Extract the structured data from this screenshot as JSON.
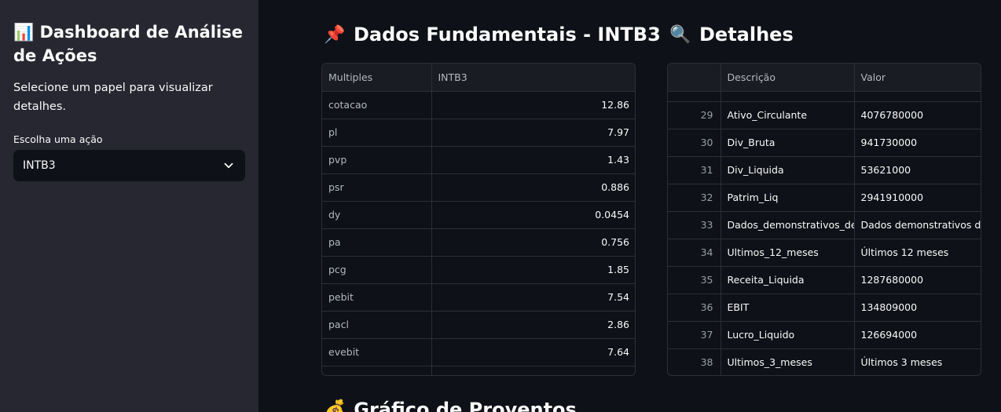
{
  "sidebar": {
    "title_icon": "📊",
    "title": "Dashboard de Análise de Ações",
    "description": "Selecione um papel para visualizar detalhes.",
    "select_label": "Escolha uma ação",
    "selected_value": "INTB3"
  },
  "fundamentals": {
    "icon": "📌",
    "title": "Dados Fundamentais - INTB3",
    "columns": [
      "Multiples",
      "INTB3"
    ],
    "rows": [
      [
        "cotacao",
        "12.86"
      ],
      [
        "pl",
        "7.97"
      ],
      [
        "pvp",
        "1.43"
      ],
      [
        "psr",
        "0.886"
      ],
      [
        "dy",
        "0.0454"
      ],
      [
        "pa",
        "0.756"
      ],
      [
        "pcg",
        "1.85"
      ],
      [
        "pebit",
        "7.54"
      ],
      [
        "pacl",
        "2.86"
      ],
      [
        "evebit",
        "7.64"
      ]
    ]
  },
  "details": {
    "icon": "🔍",
    "title": "Detalhes",
    "columns": [
      "",
      "Descrição",
      "Valor"
    ],
    "rows": [
      [
        "29",
        "Ativo_Circulante",
        "4076780000"
      ],
      [
        "30",
        "Div_Bruta",
        "941730000"
      ],
      [
        "31",
        "Div_Liquida",
        "53621000"
      ],
      [
        "32",
        "Patrim_Liq",
        "2941910000"
      ],
      [
        "33",
        "Dados_demonstrativos_de_",
        "Dados demonstrativos de r"
      ],
      [
        "34",
        "Ultimos_12_meses",
        "Últimos 12 meses"
      ],
      [
        "35",
        "Receita_Liquida",
        "1287680000"
      ],
      [
        "36",
        "EBIT",
        "134809000"
      ],
      [
        "37",
        "Lucro_Liquido",
        "126694000"
      ],
      [
        "38",
        "Ultimos_3_meses",
        "Últimos 3 meses"
      ]
    ]
  },
  "next_section": {
    "icon": "💰",
    "title": "Gráfico de Proventos"
  }
}
